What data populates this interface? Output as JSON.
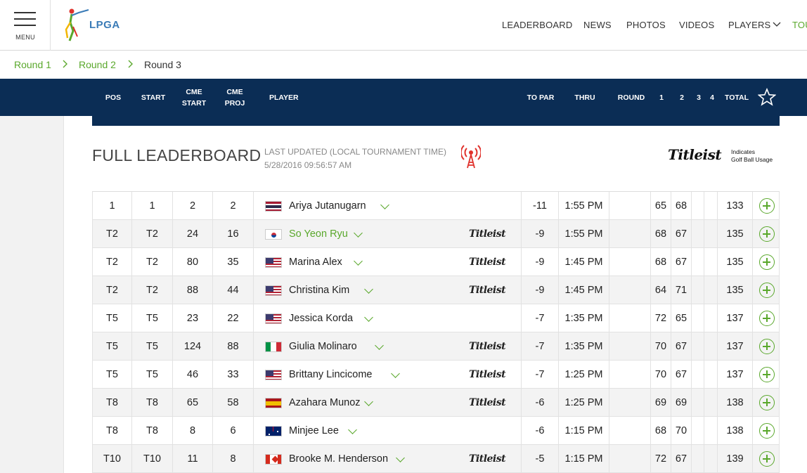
{
  "brand": {
    "logo_text": "LPGA",
    "menu_label": "MENU"
  },
  "nav": {
    "items": [
      "LEADERBOARD",
      "NEWS",
      "PHOTOS",
      "VIDEOS",
      "PLAYERS",
      "TOU"
    ]
  },
  "breadcrumb": {
    "items": [
      "Round 1",
      "Round 2",
      "Round 3"
    ],
    "current": "Round 3"
  },
  "table_header": {
    "pos": "POS",
    "start": "START",
    "cme_start": "CME START",
    "cme_proj": "CME PROJ",
    "player": "PLAYER",
    "to_par": "TO PAR",
    "thru": "THRU",
    "round": "ROUND",
    "r1": "1",
    "r2": "2",
    "r3": "3",
    "r4": "4",
    "total": "TOTAL"
  },
  "leaderboard": {
    "title": "FULL LEADERBOARD",
    "updated_label": "LAST UPDATED (LOCAL TOURNAMENT TIME)",
    "updated_value": "5/28/2016 09:56:57 AM",
    "sponsor": {
      "name": "Titleist",
      "note_line1": "Indicates",
      "note_line2": "Golf Ball Usage"
    }
  },
  "rows": [
    {
      "pos": "1",
      "start": "1",
      "cme_start": "2",
      "cme_proj": "2",
      "player": "Ariya Jutanugarn",
      "country": "thailand",
      "titleist": false,
      "to_par": "-11",
      "thru": "1:55 PM",
      "r1": "65",
      "r2": "68",
      "total": "133",
      "highlight": false
    },
    {
      "pos": "T2",
      "start": "T2",
      "cme_start": "24",
      "cme_proj": "16",
      "player": "So Yeon Ryu",
      "country": "korea",
      "titleist": true,
      "to_par": "-9",
      "thru": "1:55 PM",
      "r1": "68",
      "r2": "67",
      "total": "135",
      "highlight": true
    },
    {
      "pos": "T2",
      "start": "T2",
      "cme_start": "80",
      "cme_proj": "35",
      "player": "Marina Alex",
      "country": "usa",
      "titleist": true,
      "to_par": "-9",
      "thru": "1:45 PM",
      "r1": "68",
      "r2": "67",
      "total": "135",
      "highlight": false
    },
    {
      "pos": "T2",
      "start": "T2",
      "cme_start": "88",
      "cme_proj": "44",
      "player": "Christina Kim",
      "country": "usa",
      "titleist": true,
      "to_par": "-9",
      "thru": "1:45 PM",
      "r1": "64",
      "r2": "71",
      "total": "135",
      "highlight": false
    },
    {
      "pos": "T5",
      "start": "T5",
      "cme_start": "23",
      "cme_proj": "22",
      "player": "Jessica Korda",
      "country": "usa",
      "titleist": false,
      "to_par": "-7",
      "thru": "1:35 PM",
      "r1": "72",
      "r2": "65",
      "total": "137",
      "highlight": false
    },
    {
      "pos": "T5",
      "start": "T5",
      "cme_start": "124",
      "cme_proj": "88",
      "player": "Giulia Molinaro",
      "country": "italy",
      "titleist": true,
      "to_par": "-7",
      "thru": "1:35 PM",
      "r1": "70",
      "r2": "67",
      "total": "137",
      "highlight": false
    },
    {
      "pos": "T5",
      "start": "T5",
      "cme_start": "46",
      "cme_proj": "33",
      "player": "Brittany Lincicome",
      "country": "usa",
      "titleist": true,
      "to_par": "-7",
      "thru": "1:25 PM",
      "r1": "70",
      "r2": "67",
      "total": "137",
      "highlight": false
    },
    {
      "pos": "T8",
      "start": "T8",
      "cme_start": "65",
      "cme_proj": "58",
      "player": "Azahara Munoz",
      "country": "spain",
      "titleist": true,
      "to_par": "-6",
      "thru": "1:25 PM",
      "r1": "69",
      "r2": "69",
      "total": "138",
      "highlight": false
    },
    {
      "pos": "T8",
      "start": "T8",
      "cme_start": "8",
      "cme_proj": "6",
      "player": "Minjee Lee",
      "country": "australia",
      "titleist": false,
      "to_par": "-6",
      "thru": "1:15 PM",
      "r1": "68",
      "r2": "70",
      "total": "138",
      "highlight": false
    },
    {
      "pos": "T10",
      "start": "T10",
      "cme_start": "11",
      "cme_proj": "8",
      "player": "Brooke M. Henderson",
      "country": "canada",
      "titleist": true,
      "to_par": "-5",
      "thru": "1:15 PM",
      "r1": "72",
      "r2": "67",
      "total": "139",
      "highlight": false
    }
  ],
  "colors": {
    "navy": "#0b2d55",
    "accent_green": "#5aa82c",
    "alt_row": "#f3f3f3"
  }
}
